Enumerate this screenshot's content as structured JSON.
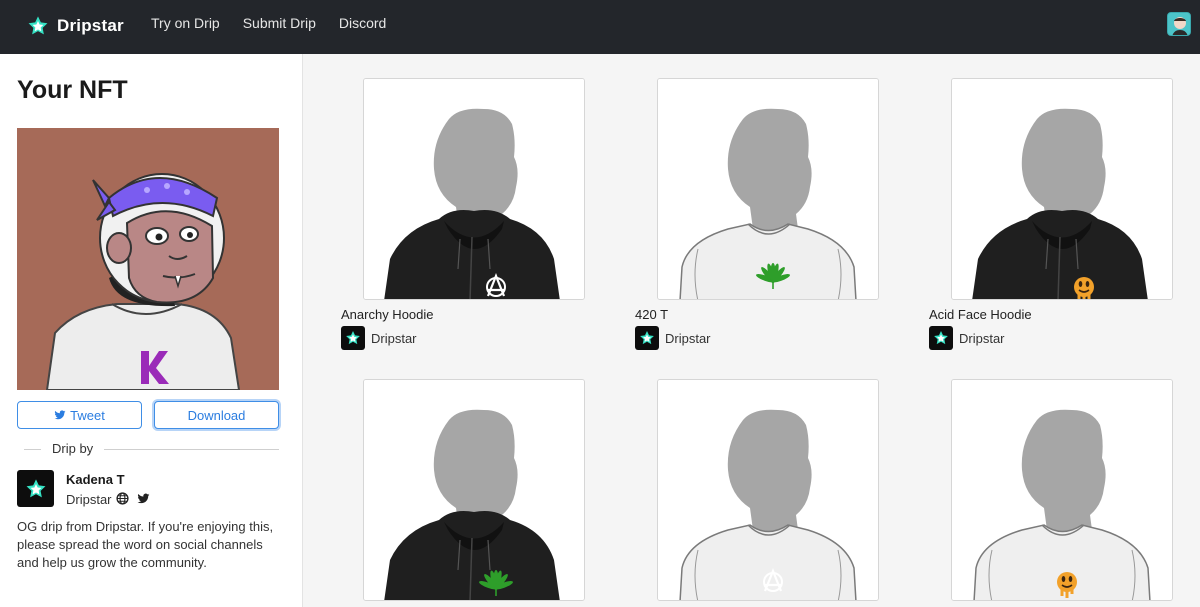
{
  "brand": {
    "name": "Dripstar",
    "accent": "#35e3c5"
  },
  "nav": {
    "links": [
      "Try on Drip",
      "Submit Drip",
      "Discord"
    ]
  },
  "sidebar": {
    "title": "Your NFT",
    "tweet_label": "Tweet",
    "download_label": "Download",
    "drip_by_label": "Drip by",
    "creator": {
      "name": "Kadena T",
      "handle": "Dripstar"
    },
    "description": "OG drip from Dripstar. If you're enjoying this, please spread the word on social channels and help us grow the community."
  },
  "grid": {
    "items": [
      {
        "title": "Anarchy Hoodie",
        "brand": "Dripstar",
        "garment": "hoodie",
        "graphic": "anarchy"
      },
      {
        "title": "420 T",
        "brand": "Dripstar",
        "garment": "tee",
        "graphic": "leaf"
      },
      {
        "title": "Acid Face Hoodie",
        "brand": "Dripstar",
        "garment": "hoodie",
        "graphic": "acidface"
      },
      {
        "title": "",
        "brand": "",
        "garment": "hoodie",
        "graphic": "leaf"
      },
      {
        "title": "",
        "brand": "",
        "garment": "tee",
        "graphic": "anarchy"
      },
      {
        "title": "",
        "brand": "",
        "garment": "tee",
        "graphic": "acidface"
      }
    ]
  },
  "colors": {
    "navbar": "#23262b",
    "nft_bg": "#a66a58",
    "link_blue": "#2b7de0"
  }
}
